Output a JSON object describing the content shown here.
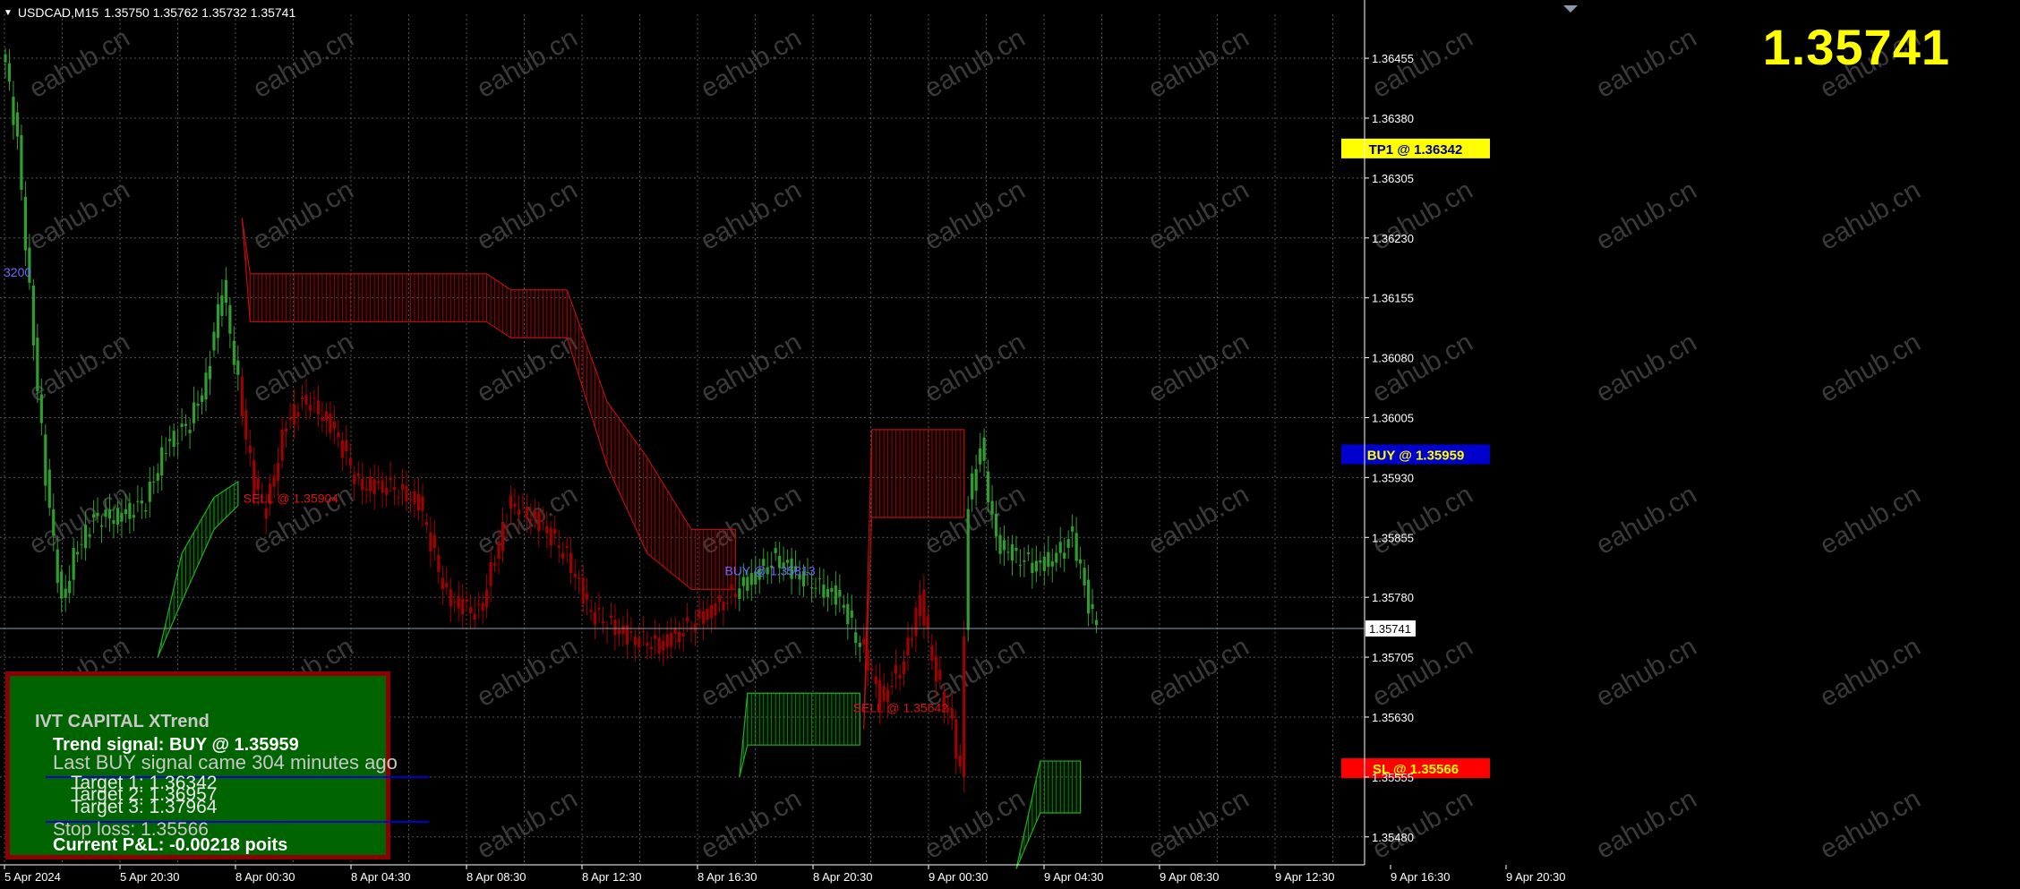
{
  "header": {
    "symbol": "USDCAD,M15",
    "ohlc": "1.35750 1.35762 1.35732 1.35741"
  },
  "big_price": "1.35741",
  "panel": {
    "title": "IVT CAPITAL XTrend",
    "trend_signal": "Trend signal: BUY @ 1.35959",
    "last_signal": "Last BUY signal came 304 minutes ago",
    "target1": "Target 1: 1.36342",
    "target2": "Target 2: 1.36957",
    "target3": "Target 3: 1.37964",
    "stop_loss": "Stop loss: 1.35566",
    "pnl": "Current P&L: -0.00218 poits"
  },
  "colors": {
    "background": "#000000",
    "bull": "#2e9e2e",
    "bear": "#a00000",
    "tp": "#ffff00",
    "buy_box": "#0000cd",
    "sl_box": "#ff0000",
    "grid": "#555555",
    "axis_text": "#ffffff"
  },
  "chart_data": {
    "type": "candlestick",
    "y_ticks": [
      "1.36455",
      "1.36380",
      "1.36305",
      "1.36230",
      "1.36155",
      "1.36080",
      "1.36005",
      "1.35930",
      "1.35855",
      "1.35780",
      "1.35705",
      "1.35630",
      "1.35555",
      "1.35480"
    ],
    "x_ticks": [
      "5 Apr 2024",
      "5 Apr 20:30",
      "8 Apr 00:30",
      "8 Apr 04:30",
      "8 Apr 08:30",
      "8 Apr 12:30",
      "8 Apr 16:30",
      "8 Apr 20:30",
      "9 Apr 00:30",
      "9 Apr 04:30",
      "9 Apr 08:30",
      "9 Apr 12:30",
      "9 Apr 16:30",
      "9 Apr 20:30"
    ],
    "ylim": [
      1.35445,
      1.3651
    ],
    "current_price": 1.35741,
    "current_price_label": "1.35741",
    "levels": [
      {
        "label": "TP1 @ 1.36342",
        "price": 1.36342,
        "kind": "tp"
      },
      {
        "label": "BUY @ 1.35959",
        "price": 1.35959,
        "kind": "buy"
      },
      {
        "label": "SL @ 1.35566",
        "price": 1.35566,
        "kind": "sl"
      }
    ],
    "signals": [
      {
        "label": "SELL @ 1.35904",
        "price": 1.35904,
        "bar": 62,
        "kind": "sell"
      },
      {
        "label": "BUY @ 1.35813",
        "price": 1.35813,
        "bar": 182,
        "kind": "buy"
      },
      {
        "label": "SELL @ 1.35642",
        "price": 1.35642,
        "bar": 214,
        "kind": "sell"
      }
    ],
    "left_label": "3200",
    "watermark": "eahub.cn",
    "close_keypoints": [
      [
        0,
        1.3645
      ],
      [
        3,
        1.3635
      ],
      [
        7,
        1.361
      ],
      [
        10,
        1.3593
      ],
      [
        12,
        1.3585
      ],
      [
        14,
        1.3577
      ],
      [
        17,
        1.3583
      ],
      [
        22,
        1.3588
      ],
      [
        28,
        1.3588
      ],
      [
        35,
        1.359
      ],
      [
        40,
        1.3597
      ],
      [
        46,
        1.36
      ],
      [
        50,
        1.3605
      ],
      [
        54,
        1.3617
      ],
      [
        57,
        1.3608
      ],
      [
        60,
        1.3598
      ],
      [
        62,
        1.3592
      ],
      [
        65,
        1.3589
      ],
      [
        70,
        1.36
      ],
      [
        75,
        1.3603
      ],
      [
        82,
        1.3599
      ],
      [
        88,
        1.3592
      ],
      [
        95,
        1.3592
      ],
      [
        103,
        1.359
      ],
      [
        110,
        1.3578
      ],
      [
        118,
        1.3576
      ],
      [
        126,
        1.359
      ],
      [
        134,
        1.3587
      ],
      [
        140,
        1.3583
      ],
      [
        146,
        1.3576
      ],
      [
        156,
        1.3573
      ],
      [
        163,
        1.3572
      ],
      [
        172,
        1.3575
      ],
      [
        180,
        1.3578
      ],
      [
        185,
        1.358
      ],
      [
        192,
        1.3583
      ],
      [
        200,
        1.358
      ],
      [
        208,
        1.3578
      ],
      [
        212,
        1.3573
      ],
      [
        215,
        1.357
      ],
      [
        218,
        1.3565
      ],
      [
        224,
        1.357
      ],
      [
        228,
        1.3578
      ],
      [
        232,
        1.3568
      ],
      [
        236,
        1.3562
      ],
      [
        238,
        1.3556
      ],
      [
        240,
        1.359
      ],
      [
        243,
        1.3597
      ],
      [
        247,
        1.3585
      ],
      [
        252,
        1.3583
      ],
      [
        257,
        1.3582
      ],
      [
        262,
        1.3583
      ],
      [
        266,
        1.3586
      ],
      [
        270,
        1.3577
      ],
      [
        272,
        1.3575
      ]
    ],
    "direction_segments": [
      [
        0,
        58,
        "up"
      ],
      [
        59,
        182,
        "down"
      ],
      [
        183,
        213,
        "up"
      ],
      [
        214,
        239,
        "down"
      ],
      [
        240,
        272,
        "up"
      ]
    ],
    "channels": [
      {
        "kind": "bull",
        "points": [
          [
            38,
            1.35705,
            1.35705
          ],
          [
            44,
            1.35775,
            1.35835
          ],
          [
            52,
            1.35865,
            1.35905
          ],
          [
            58,
            1.35895,
            1.35925
          ]
        ]
      },
      {
        "kind": "bear",
        "points": [
          [
            59,
            1.36255,
            1.36255
          ],
          [
            61,
            1.36125,
            1.36185
          ],
          [
            120,
            1.36125,
            1.36185
          ],
          [
            126,
            1.36105,
            1.36165
          ],
          [
            140,
            1.36105,
            1.36165
          ],
          [
            150,
            1.35945,
            1.36025
          ],
          [
            160,
            1.35835,
            1.35955
          ],
          [
            171,
            1.3579,
            1.35865
          ],
          [
            182,
            1.3579,
            1.35865
          ]
        ]
      },
      {
        "kind": "bull",
        "points": [
          [
            183,
            1.35555,
            1.35555
          ],
          [
            185,
            1.35595,
            1.3566
          ],
          [
            213,
            1.35595,
            1.3566
          ]
        ]
      },
      {
        "kind": "bear",
        "points": [
          [
            214,
            1.35615,
            1.35615
          ],
          [
            216,
            1.3588,
            1.3599
          ],
          [
            239,
            1.3588,
            1.3599
          ]
        ]
      },
      {
        "kind": "bull",
        "points": [
          [
            252,
            1.3544,
            1.3544
          ],
          [
            258,
            1.3551,
            1.35575
          ],
          [
            268,
            1.3551,
            1.35575
          ]
        ]
      }
    ]
  }
}
